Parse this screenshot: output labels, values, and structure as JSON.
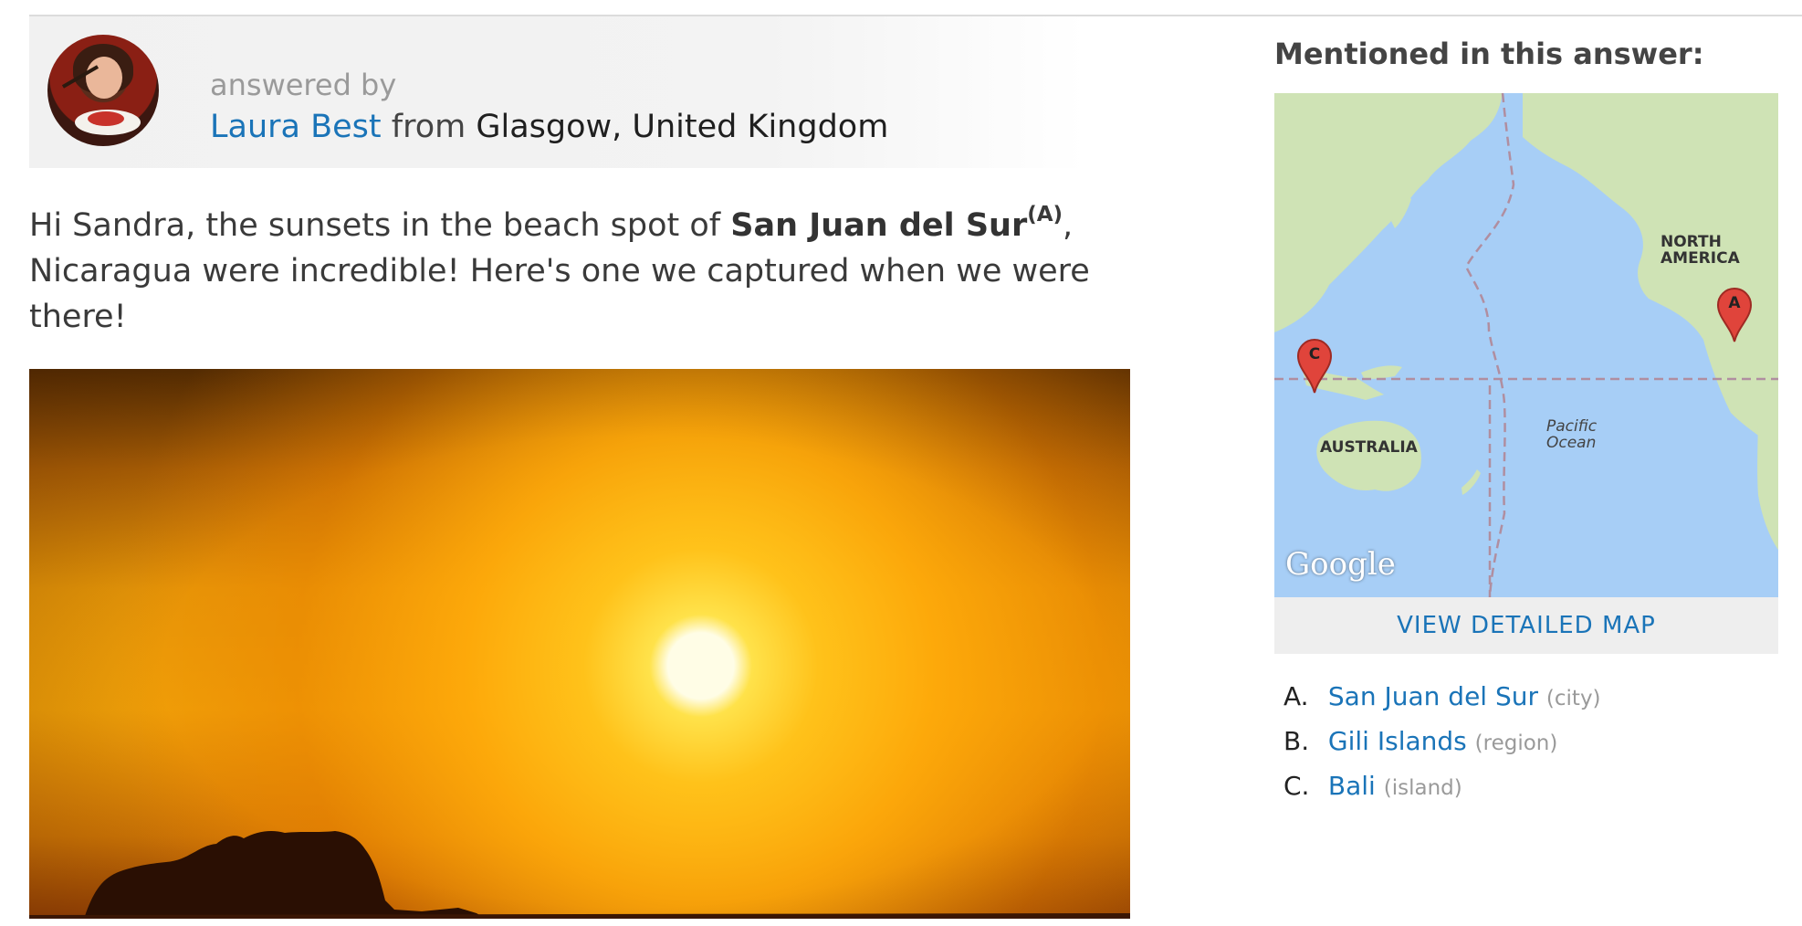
{
  "answer": {
    "answered_by_label": "answered by",
    "author_name": "Laura Best",
    "from_label": "from",
    "author_location": "Glasgow, United Kingdom",
    "text_before": "Hi Sandra, the sunsets in the beach spot of ",
    "place_name": "San Juan del Sur",
    "place_ref": "(A)",
    "text_after": ", Nicaragua were incredible! Here's one we captured when we were there!"
  },
  "sidebar": {
    "title": "Mentioned in this answer:",
    "map": {
      "labels": {
        "north_america": "NORTH AMERICA",
        "pacific_ocean": "Pacific Ocean",
        "australia": "AUSTRALIA"
      },
      "logo": "Google",
      "pins": [
        {
          "letter": "A"
        },
        {
          "letter": "C"
        }
      ]
    },
    "view_map_label": "VIEW DETAILED MAP",
    "places": [
      {
        "marker": "A.",
        "name": "San Juan del Sur",
        "type": "(city)"
      },
      {
        "marker": "B.",
        "name": "Gili Islands",
        "type": "(region)"
      },
      {
        "marker": "C.",
        "name": "Bali",
        "type": "(island)"
      }
    ]
  },
  "colors": {
    "link": "#1a74b8",
    "muted": "#9a9a9a",
    "pin": "#e0443b",
    "ocean": "#a7cef6",
    "land": "#cfe3b5"
  }
}
